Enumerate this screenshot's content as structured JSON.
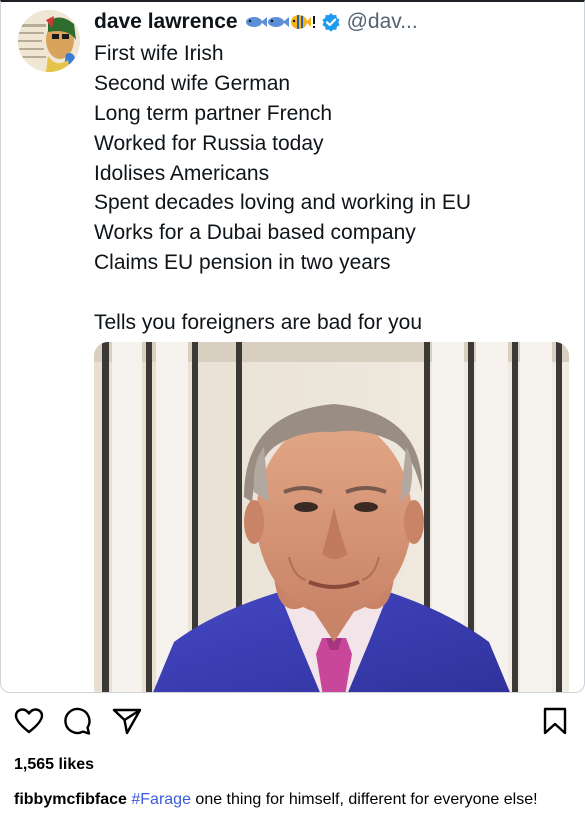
{
  "tweet": {
    "display_name": "dave lawrence",
    "handle": "@dav...",
    "name_emoji_icons": [
      "fish-icon",
      "fish-icon",
      "tropical-fish-icon",
      "exclamation-icon"
    ],
    "verified_icon": "verified-badge-icon",
    "lines": [
      "First wife Irish",
      "Second wife German",
      "Long term partner French",
      "Worked for Russia today",
      "Idolises Americans",
      "Spent decades loving and working in EU",
      "Works for a Dubai based company",
      "Claims EU pension in two years",
      "",
      "Tells you foreigners are bad for you"
    ]
  },
  "post": {
    "action_icons": [
      "heart-icon",
      "comment-icon",
      "share-icon",
      "bookmark-icon"
    ],
    "likes": "1,565 likes",
    "caption": {
      "username": "fibbymcfibface",
      "hashtag": "#Farage",
      "text": " one thing for himself, different for everyone else!"
    }
  },
  "colors": {
    "handle": "#536471",
    "verified": "#1d9bf0",
    "hashtag": "#3b5bdb",
    "suit": "#3b3fb5",
    "tie": "#c8479a"
  }
}
